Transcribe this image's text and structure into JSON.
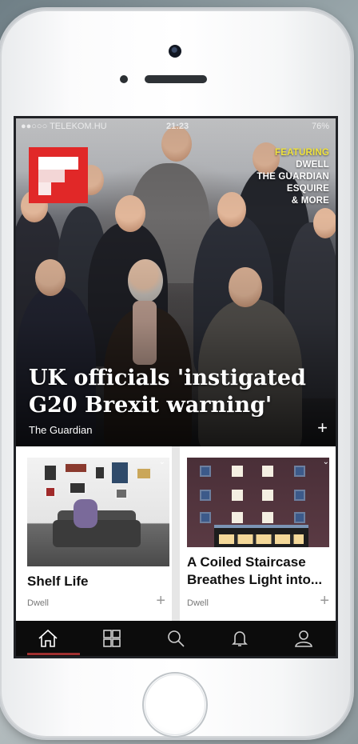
{
  "status_bar": {
    "carrier": "●●○○○ TELEKOM.HU",
    "time": "21:23",
    "battery": "76%"
  },
  "logo": {
    "icon": "flipboard-logo",
    "color": "#e12828"
  },
  "featuring": {
    "label": "FEATURING",
    "sources": [
      "DWELL",
      "THE GUARDIAN",
      "ESQUIRE",
      "& MORE"
    ]
  },
  "hero": {
    "headline": "UK officials 'instigated G20 Brexit warning'",
    "source": "The Guardian",
    "plus": "+"
  },
  "cards": [
    {
      "title": "Shelf Life",
      "source": "Dwell",
      "plus": "+",
      "chevron": "⌄"
    },
    {
      "title": "A Coiled Staircase Breathes Light into...",
      "source": "Dwell",
      "plus": "+",
      "chevron": "⌄"
    }
  ],
  "tabbar": {
    "tabs": [
      "home-icon",
      "grid-icon",
      "search-icon",
      "bell-icon",
      "profile-icon"
    ],
    "active": "home-icon"
  },
  "colors": {
    "accent": "#e12828",
    "featuring": "#f0e33c",
    "tabbar": "#0c0c0c"
  }
}
